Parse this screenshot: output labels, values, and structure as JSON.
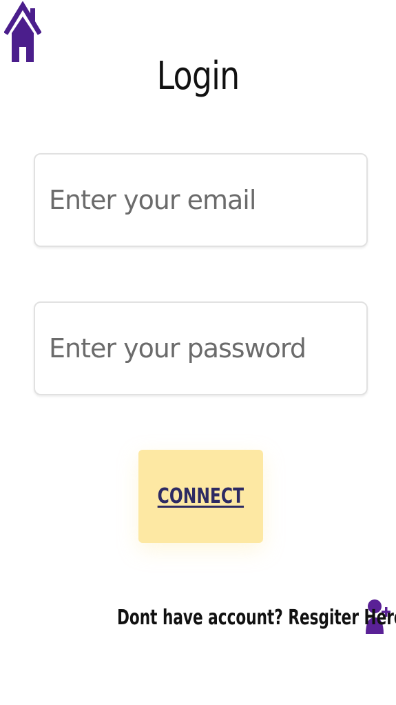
{
  "nav": {
    "home_icon": "home-icon",
    "accent_color": "#4b1e8c"
  },
  "page": {
    "title": "Login"
  },
  "form": {
    "email_placeholder": "Enter your email",
    "email_value": "",
    "password_placeholder": "Enter your password",
    "password_value": "",
    "connect_label": "CONNECT",
    "connect_bg_color": "#fde8a3",
    "connect_text_color": "#2d2a63"
  },
  "register": {
    "prompt": "Dont have account?",
    "link_label": "Resgiter Here",
    "icon": "user-plus-icon",
    "icon_color": "#5a2196"
  }
}
